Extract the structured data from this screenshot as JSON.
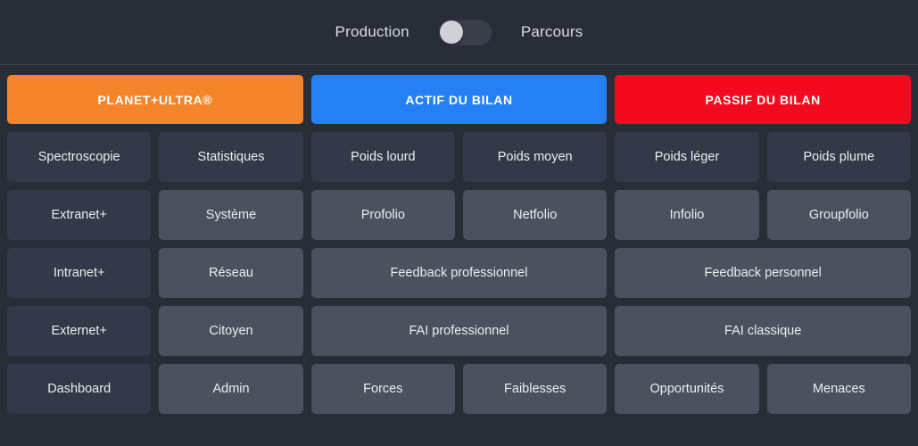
{
  "topbar": {
    "left_label": "Production",
    "right_label": "Parcours",
    "toggle_state": "off"
  },
  "colors": {
    "background": "#282d38",
    "separator": "#424754",
    "cell_dark": "#333948",
    "cell_light": "#4b515e",
    "planet_orange": "#f5852a",
    "actif_blue": "#2680f5",
    "passif_red": "#f40a1e",
    "text": "#eceef2",
    "toggle_track": "#3a3f4b",
    "toggle_knob": "#ced1d7"
  },
  "sections": [
    {
      "header": "PLANET+ULTRA®",
      "header_color": "#f5852a",
      "rows": [
        {
          "cells": [
            {
              "label": "Spectroscopie",
              "tone": "dark"
            },
            {
              "label": "Statistiques",
              "tone": "dark"
            }
          ]
        },
        {
          "cells": [
            {
              "label": "Extranet+",
              "tone": "dark"
            },
            {
              "label": "Système",
              "tone": "light"
            }
          ]
        },
        {
          "cells": [
            {
              "label": "Intranet+",
              "tone": "dark"
            },
            {
              "label": "Réseau",
              "tone": "light"
            }
          ]
        },
        {
          "cells": [
            {
              "label": "Externet+",
              "tone": "dark"
            },
            {
              "label": "Citoyen",
              "tone": "light"
            }
          ]
        },
        {
          "cells": [
            {
              "label": "Dashboard",
              "tone": "dark"
            },
            {
              "label": "Admin",
              "tone": "light"
            }
          ]
        }
      ]
    },
    {
      "header": "ACTIF DU BILAN",
      "header_color": "#2680f5",
      "rows": [
        {
          "cells": [
            {
              "label": "Poids lourd",
              "tone": "dark"
            },
            {
              "label": "Poids moyen",
              "tone": "dark"
            }
          ]
        },
        {
          "cells": [
            {
              "label": "Profolio",
              "tone": "light"
            },
            {
              "label": "Netfolio",
              "tone": "light"
            }
          ]
        },
        {
          "cells": [
            {
              "label": "Feedback professionnel",
              "tone": "light",
              "wide": true
            }
          ]
        },
        {
          "cells": [
            {
              "label": "FAI professionnel",
              "tone": "light",
              "wide": true
            }
          ]
        },
        {
          "cells": [
            {
              "label": "Forces",
              "tone": "light"
            },
            {
              "label": "Faiblesses",
              "tone": "light"
            }
          ]
        }
      ]
    },
    {
      "header": "PASSIF DU BILAN",
      "header_color": "#f40a1e",
      "rows": [
        {
          "cells": [
            {
              "label": "Poids léger",
              "tone": "dark"
            },
            {
              "label": "Poids plume",
              "tone": "dark"
            }
          ]
        },
        {
          "cells": [
            {
              "label": "Infolio",
              "tone": "light"
            },
            {
              "label": "Groupfolio",
              "tone": "light"
            }
          ]
        },
        {
          "cells": [
            {
              "label": "Feedback personnel",
              "tone": "light",
              "wide": true
            }
          ]
        },
        {
          "cells": [
            {
              "label": "FAI classique",
              "tone": "light",
              "wide": true
            }
          ]
        },
        {
          "cells": [
            {
              "label": "Opportunités",
              "tone": "light"
            },
            {
              "label": "Menaces",
              "tone": "light"
            }
          ]
        }
      ]
    }
  ]
}
